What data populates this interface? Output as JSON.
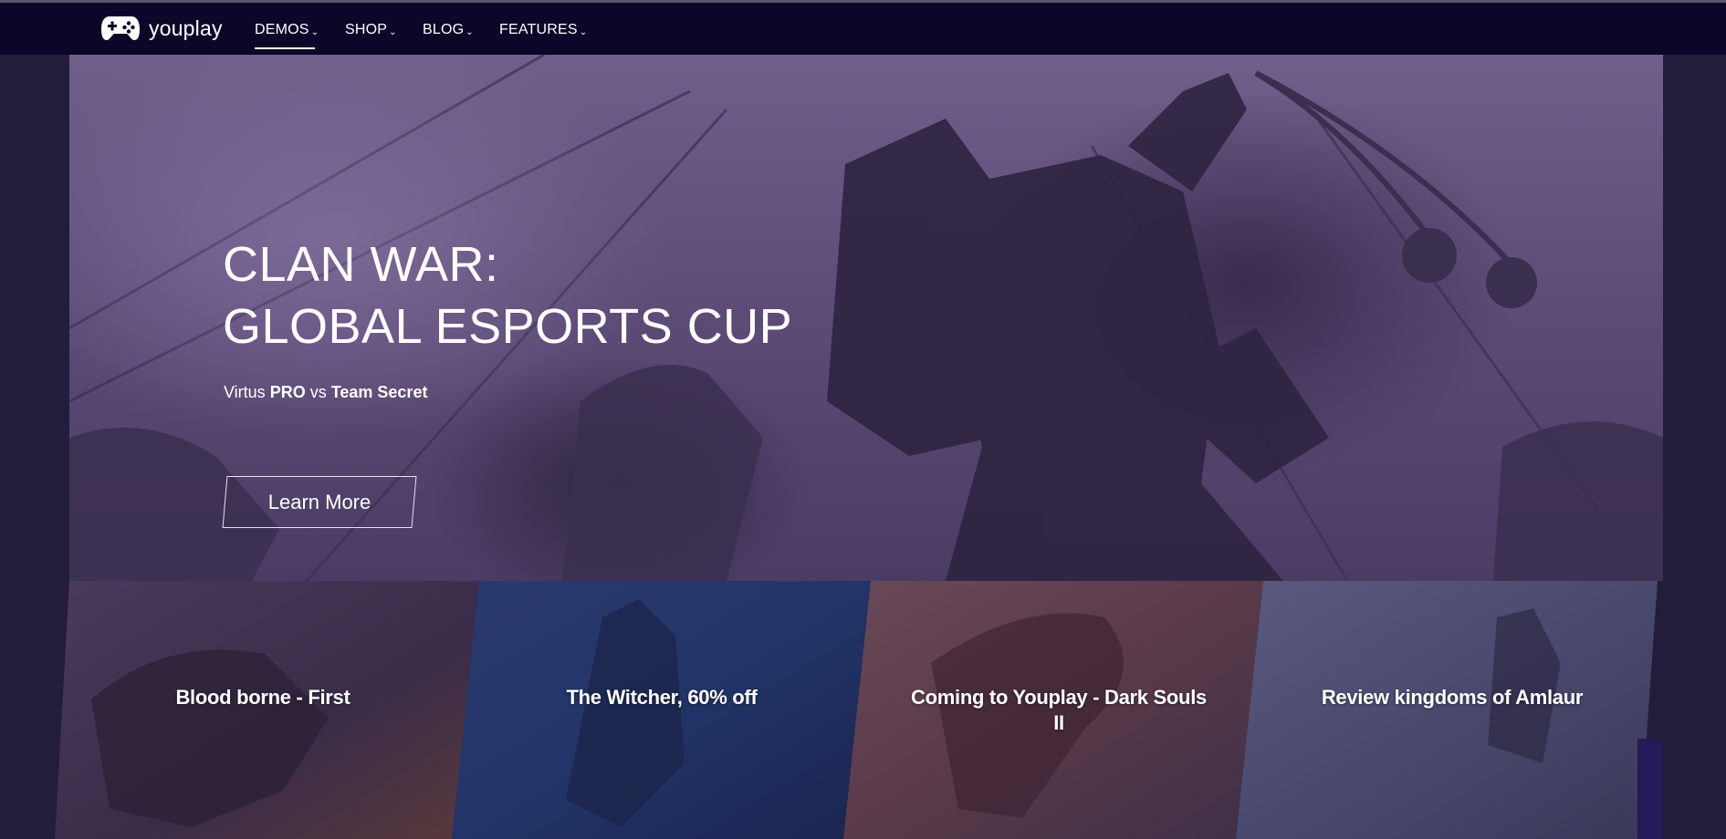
{
  "brand": {
    "name": "youplay",
    "logo_icon": "gamepad-icon"
  },
  "nav": {
    "items": [
      {
        "label": "DEMOS",
        "active": true
      },
      {
        "label": "SHOP",
        "active": false
      },
      {
        "label": "BLOG",
        "active": false
      },
      {
        "label": "FEATURES",
        "active": false
      }
    ],
    "caret": "⌄"
  },
  "hero": {
    "title_line1": "CLAN WAR:",
    "title_line2": "GLOBAL ESPORTS CUP",
    "subtitle_prefix": "Virtus ",
    "team1": "PRO",
    "versus": " vs ",
    "team2": "Team Secret",
    "button_label": "Learn More"
  },
  "tiles": [
    {
      "title": "Blood borne - First"
    },
    {
      "title": "The Witcher, 60% off"
    },
    {
      "title": "Coming to Youplay - Dark Souls II"
    },
    {
      "title": "Review kingdoms of Amlaur"
    }
  ],
  "colors": {
    "navbar_bg": "#0c0628",
    "page_bg": "#221d3a",
    "hero_tint": "#5d4d78"
  }
}
